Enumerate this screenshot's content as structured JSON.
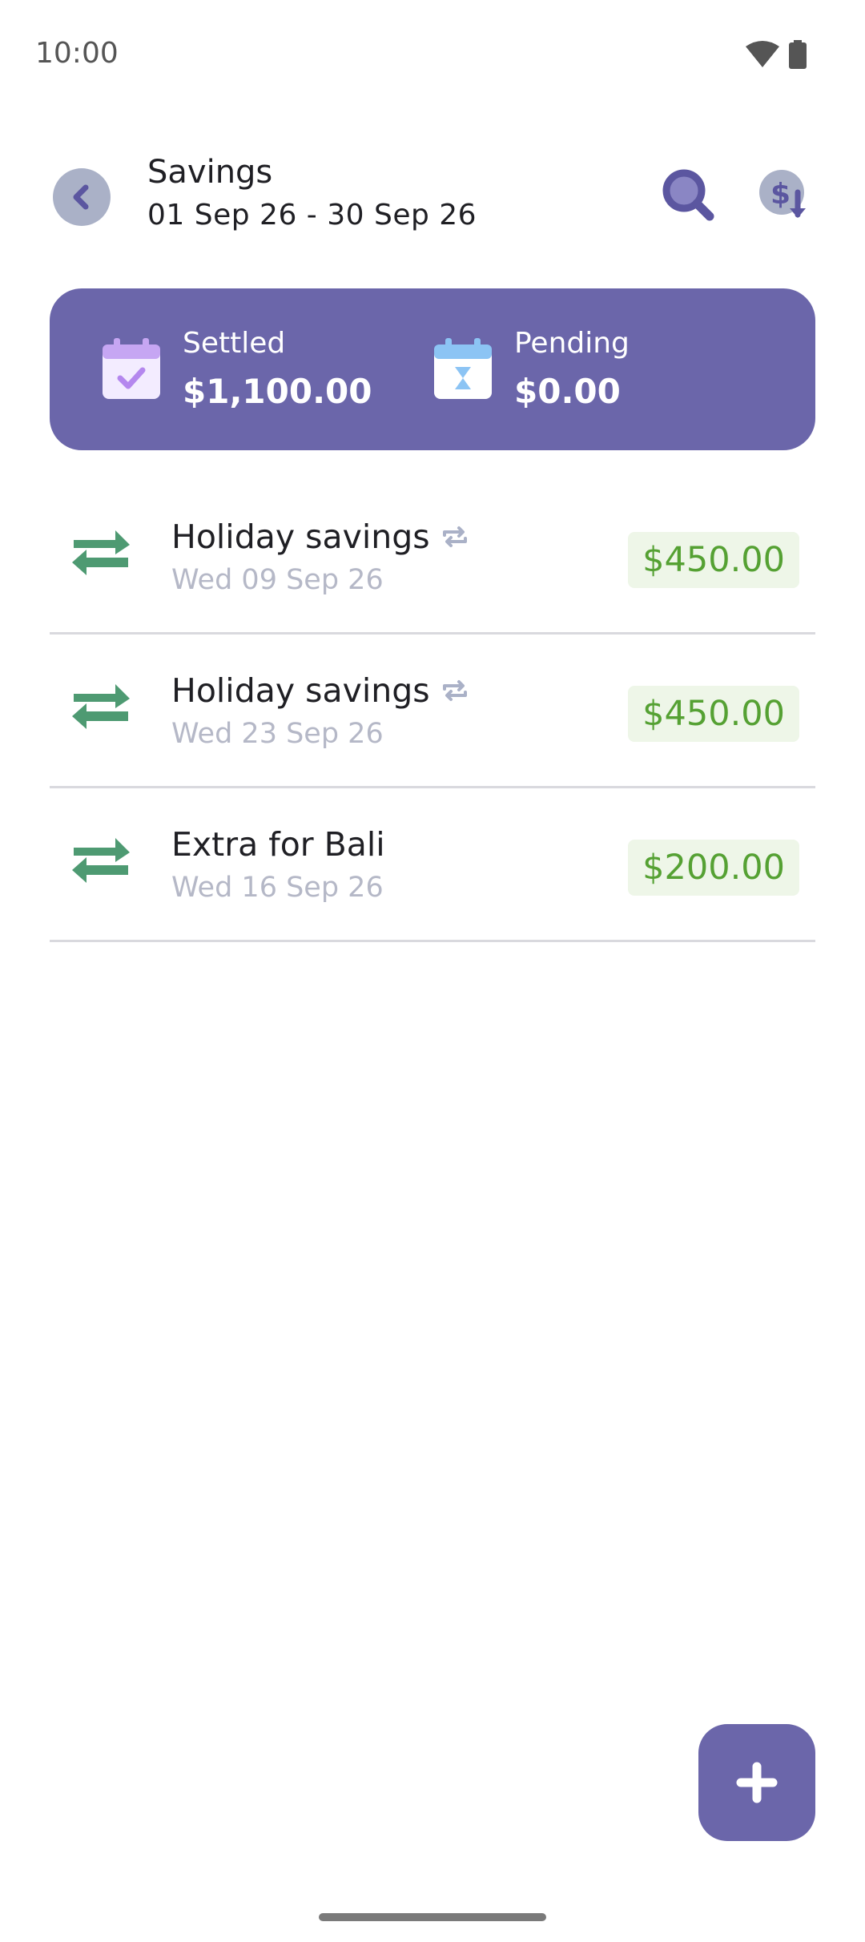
{
  "status_bar": {
    "time": "10:00"
  },
  "header": {
    "title": "Savings",
    "date_range": "01 Sep 26 - 30 Sep 26"
  },
  "summary": {
    "settled_label": "Settled",
    "settled_value": "$1,100.00",
    "pending_label": "Pending",
    "pending_value": "$0.00"
  },
  "transactions": [
    {
      "title": "Holiday savings",
      "date": "Wed 09 Sep 26",
      "amount": "$450.00",
      "recurring": true
    },
    {
      "title": "Holiday savings",
      "date": "Wed 23 Sep 26",
      "amount": "$450.00",
      "recurring": true
    },
    {
      "title": "Extra for Bali",
      "date": "Wed 16 Sep 26",
      "amount": "$200.00",
      "recurring": false
    }
  ],
  "colors": {
    "accent": "#6b66aa",
    "transfer_icon": "#4e9a72",
    "amount_text": "#55a133",
    "amount_bg": "#eef6e8",
    "muted_text": "#b5b8c7"
  },
  "icons": {
    "back": "chevron-left-icon",
    "search": "search-icon",
    "export": "dollar-download-icon",
    "settled": "calendar-check-icon",
    "pending": "calendar-hourglass-icon",
    "transaction": "transfer-arrows-icon",
    "recurring": "repeat-icon",
    "add": "plus-icon"
  }
}
